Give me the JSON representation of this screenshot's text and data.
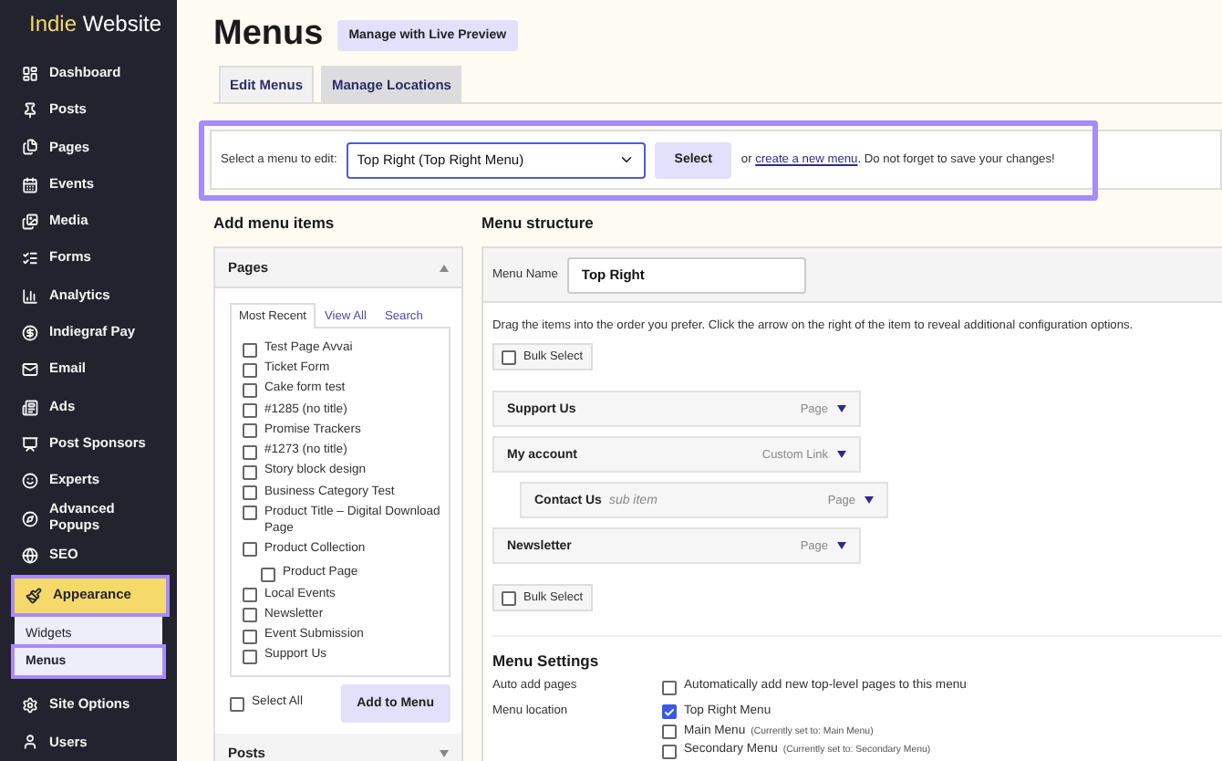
{
  "sidebar": {
    "brand": {
      "accent": "Indie",
      "rest": "Website"
    },
    "items": [
      {
        "label": "Dashboard",
        "selected": false,
        "highlighted": false
      },
      {
        "label": "Posts",
        "selected": false,
        "highlighted": false
      },
      {
        "label": "Pages",
        "selected": false,
        "highlighted": false
      },
      {
        "label": "Events",
        "selected": false,
        "highlighted": false
      },
      {
        "label": "Media",
        "selected": false,
        "highlighted": false
      },
      {
        "label": "Forms",
        "selected": false,
        "highlighted": false
      },
      {
        "label": "Analytics",
        "selected": false,
        "highlighted": false
      },
      {
        "label": "Indiegraf Pay",
        "selected": false,
        "highlighted": false
      },
      {
        "label": "Email",
        "selected": false,
        "highlighted": false
      },
      {
        "label": "Ads",
        "selected": false,
        "highlighted": false
      },
      {
        "label": "Post Sponsors",
        "selected": false,
        "highlighted": false
      },
      {
        "label": "Experts",
        "selected": false,
        "highlighted": false
      },
      {
        "label": "Advanced Popups",
        "selected": false,
        "highlighted": false
      },
      {
        "label": "SEO",
        "selected": false,
        "highlighted": false
      },
      {
        "label": "Appearance",
        "selected": true,
        "highlighted": true,
        "children": [
          {
            "label": "Widgets",
            "selected": false,
            "highlighted": false
          },
          {
            "label": "Menus",
            "selected": true,
            "highlighted": true
          }
        ]
      },
      {
        "label": "Site Options",
        "selected": false,
        "highlighted": false
      },
      {
        "label": "Users",
        "selected": false,
        "highlighted": false
      }
    ]
  },
  "header": {
    "title": "Menus",
    "preview_button": "Manage with Live Preview"
  },
  "tabs": [
    {
      "label": "Edit Menus",
      "selected": true
    },
    {
      "label": "Manage Locations",
      "selected": false
    }
  ],
  "select_bar": {
    "highlighted": true,
    "label": "Select a menu to edit:",
    "value": "Top Right (Top Right Menu)",
    "button": "Select",
    "text_before": "or",
    "link": "create a new menu",
    "text_after": ". Do not forget to save your changes!"
  },
  "add_items": {
    "title": "Add menu items",
    "panels": [
      {
        "title": "Pages",
        "expanded": true,
        "tabs": [
          {
            "label": "Most Recent",
            "selected": true
          },
          {
            "label": "View All",
            "selected": false
          },
          {
            "label": "Search",
            "selected": false
          }
        ],
        "items": [
          {
            "label": "Test Page Avvai",
            "checked": false
          },
          {
            "label": "Ticket Form",
            "checked": false
          },
          {
            "label": "Cake form test",
            "checked": false
          },
          {
            "label": "#1285 (no title)",
            "checked": false
          },
          {
            "label": "Promise Trackers",
            "checked": false
          },
          {
            "label": "#1273 (no title)",
            "checked": false
          },
          {
            "label": "Story block design",
            "checked": false
          },
          {
            "label": "Business Category Test",
            "checked": false
          },
          {
            "label": "Product Title – Digital Download Page",
            "checked": false
          },
          {
            "label": "Product Collection",
            "checked": false,
            "children": [
              {
                "label": "Product Page",
                "checked": false
              }
            ]
          },
          {
            "label": "Local Events",
            "checked": false
          },
          {
            "label": "Newsletter",
            "checked": false
          },
          {
            "label": "Event Submission",
            "checked": false
          },
          {
            "label": "Support Us",
            "checked": false
          }
        ],
        "select_all": {
          "label": "Select All",
          "checked": false
        },
        "button": "Add to Menu"
      },
      {
        "title": "Posts",
        "expanded": false
      }
    ]
  },
  "structure": {
    "title": "Menu structure",
    "name_label": "Menu Name",
    "name_value": "Top Right",
    "instructions": "Drag the items into the order you prefer. Click the arrow on the right of the item to reveal additional configuration options.",
    "bulk_select_top": {
      "label": "Bulk Select",
      "checked": false
    },
    "items": [
      {
        "title": "Support Us",
        "type": "Page"
      },
      {
        "title": "My account",
        "type": "Custom Link",
        "children": [
          {
            "title": "Contact Us",
            "note": "sub item",
            "type": "Page"
          }
        ]
      },
      {
        "title": "Newsletter",
        "type": "Page"
      }
    ],
    "bulk_select_bottom": {
      "label": "Bulk Select",
      "checked": false
    },
    "settings": {
      "title": "Menu Settings",
      "rows": [
        {
          "label": "Auto add pages",
          "options": [
            {
              "label": "Automatically add new top-level pages to this menu",
              "checked": false
            }
          ]
        },
        {
          "label": "Menu location",
          "options": [
            {
              "label": "Top Right Menu",
              "checked": true
            },
            {
              "label": "Main Menu",
              "note": "(Currently set to: Main Menu)",
              "checked": false
            },
            {
              "label": "Secondary Menu",
              "note": "(Currently set to: Secondary Menu)",
              "checked": false
            }
          ]
        }
      ]
    }
  }
}
